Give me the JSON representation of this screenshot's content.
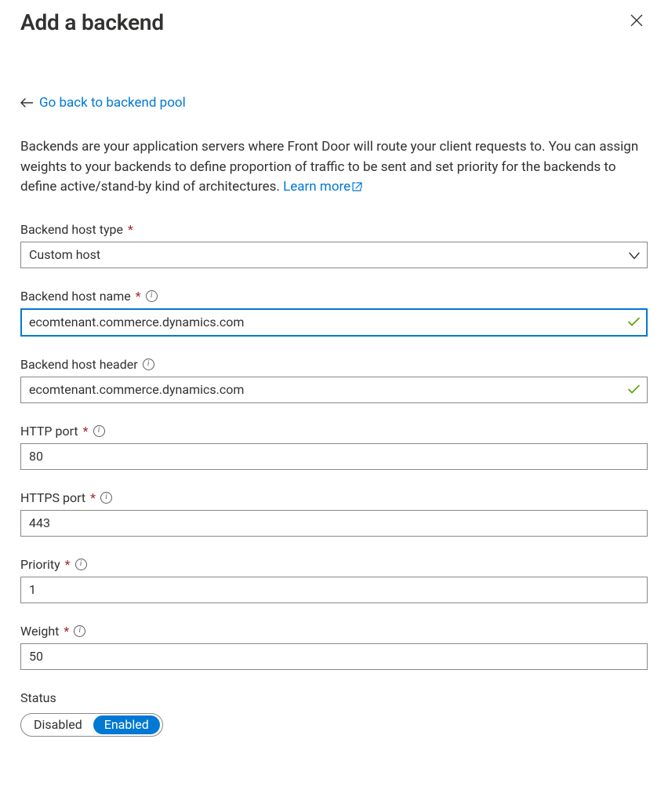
{
  "header": {
    "title": "Add a backend"
  },
  "back_link": {
    "label": "Go back to backend pool"
  },
  "description": {
    "text": "Backends are your application servers where Front Door will route your client requests to. You can assign weights to your backends to define proportion of traffic to be sent and set priority for the backends to define active/stand-by kind of architectures. ",
    "learn_more": "Learn more"
  },
  "fields": {
    "host_type": {
      "label": "Backend host type",
      "required": true,
      "value": "Custom host"
    },
    "host_name": {
      "label": "Backend host name",
      "required": true,
      "info": true,
      "value": "ecomtenant.commerce.dynamics.com",
      "valid": true,
      "focused": true
    },
    "host_header": {
      "label": "Backend host header",
      "required": false,
      "info": true,
      "value": "ecomtenant.commerce.dynamics.com",
      "valid": true
    },
    "http_port": {
      "label": "HTTP port",
      "required": true,
      "info": true,
      "value": "80"
    },
    "https_port": {
      "label": "HTTPS port",
      "required": true,
      "info": true,
      "value": "443"
    },
    "priority": {
      "label": "Priority",
      "required": true,
      "info": true,
      "value": "1"
    },
    "weight": {
      "label": "Weight",
      "required": true,
      "info": true,
      "value": "50"
    },
    "status": {
      "label": "Status",
      "options": {
        "disabled": "Disabled",
        "enabled": "Enabled"
      },
      "value": "Enabled"
    }
  }
}
